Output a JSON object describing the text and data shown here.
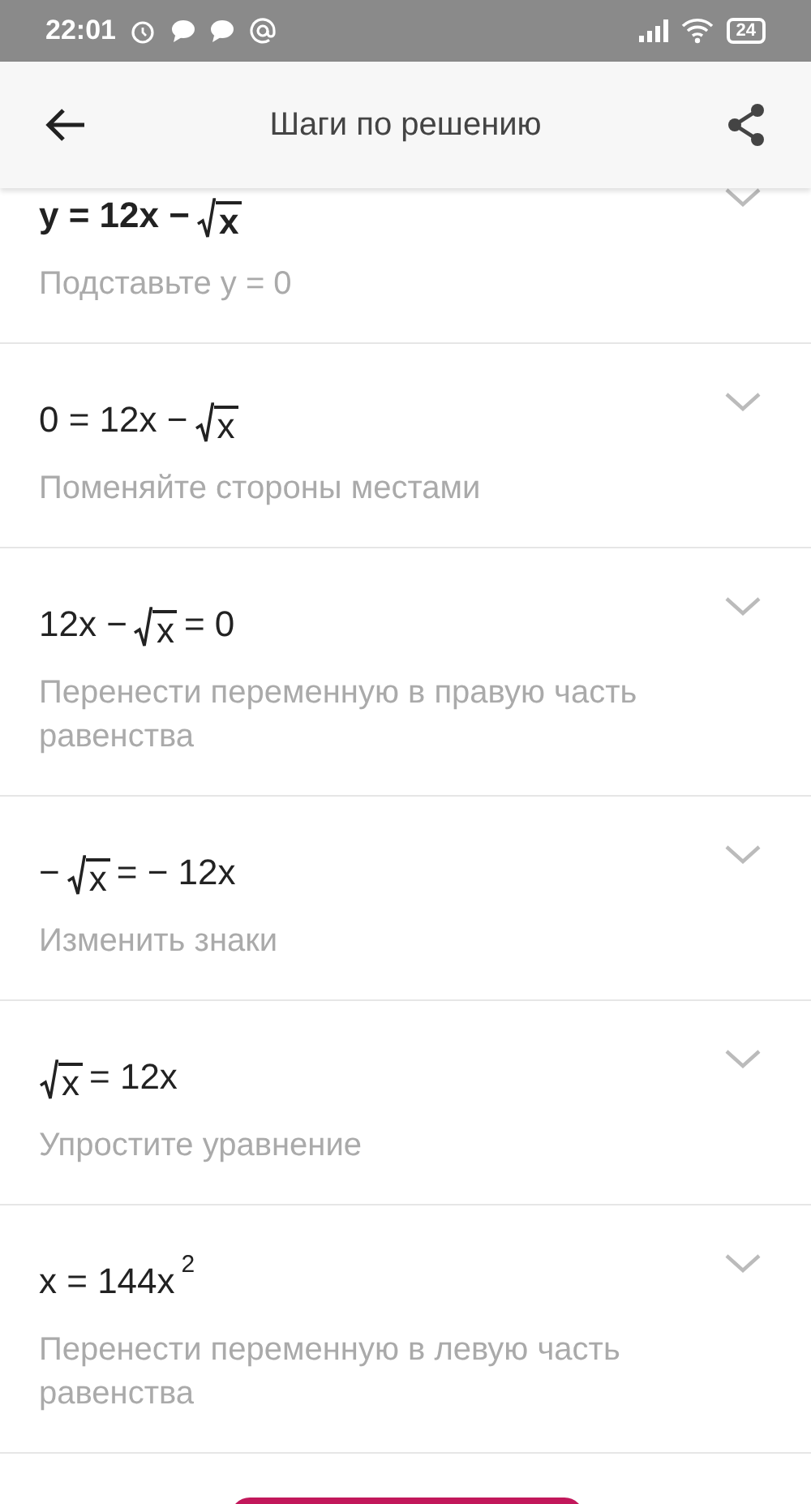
{
  "status_bar": {
    "time": "22:01",
    "battery": "24"
  },
  "header": {
    "title": "Шаги по решению"
  },
  "steps": [
    {
      "bold": true,
      "equation": [
        {
          "kind": "text",
          "text": "y = 12x −"
        },
        {
          "kind": "sqrt",
          "text": "x"
        }
      ],
      "description": "Подставьте y = 0"
    },
    {
      "bold": false,
      "equation": [
        {
          "kind": "text",
          "text": "0 = 12x −"
        },
        {
          "kind": "sqrt",
          "text": "x"
        }
      ],
      "description": "Поменяйте стороны местами"
    },
    {
      "bold": false,
      "equation": [
        {
          "kind": "text",
          "text": "12x −"
        },
        {
          "kind": "sqrt",
          "text": "x"
        },
        {
          "kind": "text",
          "text": "= 0"
        }
      ],
      "description": "Перенести переменную в правую часть равенства"
    },
    {
      "bold": false,
      "equation": [
        {
          "kind": "text",
          "text": "−"
        },
        {
          "kind": "sqrt",
          "text": "x"
        },
        {
          "kind": "text",
          "text": "= − 12x"
        }
      ],
      "description": "Изменить знаки"
    },
    {
      "bold": false,
      "equation": [
        {
          "kind": "sqrt",
          "text": "x"
        },
        {
          "kind": "text",
          "text": "= 12x"
        }
      ],
      "description": "Упростите уравнение"
    },
    {
      "bold": false,
      "equation": [
        {
          "kind": "text",
          "text": "x = 144x"
        },
        {
          "kind": "sup",
          "text": "2"
        }
      ],
      "description": "Перенести переменную в левую часть равенства"
    }
  ]
}
